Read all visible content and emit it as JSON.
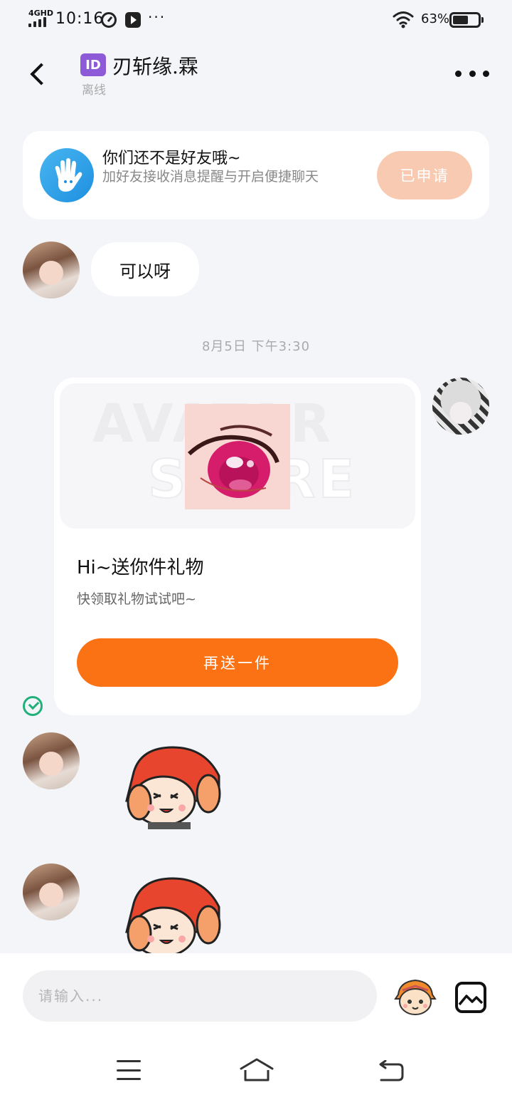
{
  "status_bar": {
    "network": "4GHD",
    "time": "10:16",
    "more": "···",
    "battery_percent": "63%",
    "battery_level": 0.63
  },
  "header": {
    "id_badge": "ID",
    "contact_name": "刃斩缘.霖",
    "contact_status": "离线"
  },
  "friend_card": {
    "title": "你们还不是好友哦~",
    "description": "加好友接收消息提醒与开启便捷聊天",
    "button_label": "已申请"
  },
  "messages": {
    "text_1": "可以呀",
    "timestamp": "8月5日 下午3:30"
  },
  "gift_card": {
    "watermark_line1": "AVATAR",
    "watermark_line2": "STORE",
    "title": "Hi~送你件礼物",
    "subtitle": "快领取礼物试试吧~",
    "button_label": "再送一件"
  },
  "input_bar": {
    "placeholder": "请输入..."
  },
  "colors": {
    "accent_orange": "#fb7214",
    "applied_button": "#f9cab2",
    "id_badge": "#8e5bd8",
    "read_check": "#21b07a",
    "background": "#f4f5f9"
  },
  "icons": [
    "back-arrow-icon",
    "more-dots-icon",
    "wave-hand-icon",
    "read-check-icon",
    "emoji-sticker-icon",
    "image-icon",
    "menu-icon",
    "home-icon",
    "back-nav-icon"
  ]
}
